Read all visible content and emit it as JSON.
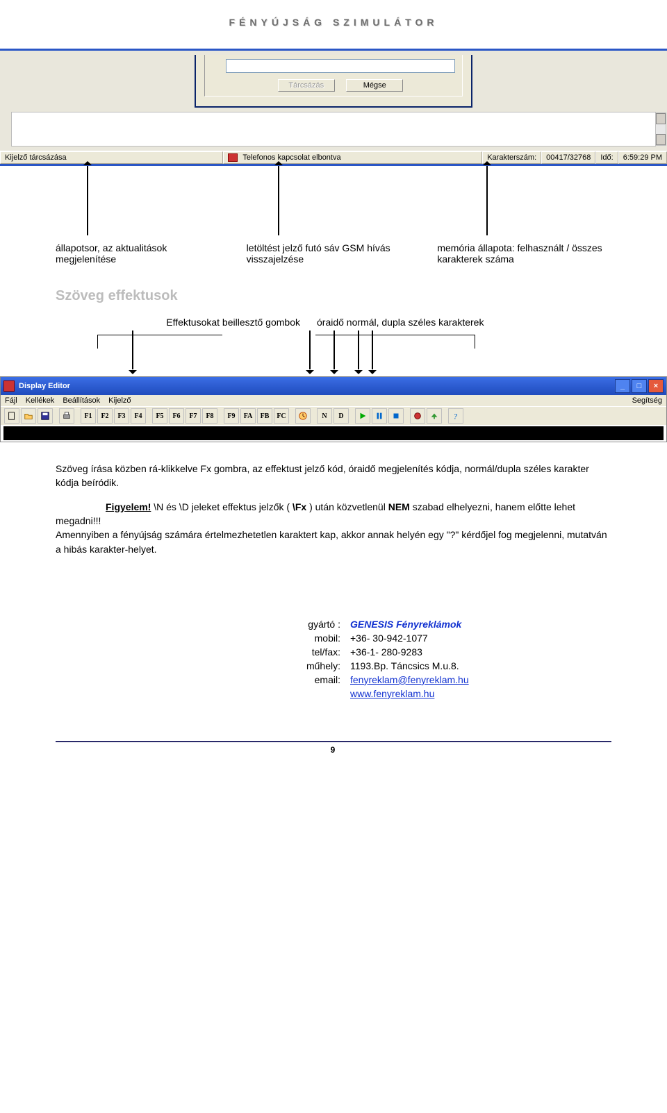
{
  "header_title": "FÉNYÚJSÁG SZIMULÁTOR",
  "dialog": {
    "btn_dial": "Tárcsázás",
    "btn_cancel": "Mégse"
  },
  "statusbar": {
    "cell1": "Kijelző tárcsázása",
    "cell2": "Telefonos kapcsolat elbontva",
    "cell3_label": "Karakterszám:",
    "cell3_value": "00417/32768",
    "cell4_label": "Idő:",
    "cell4_value": "6:59:29 PM"
  },
  "cols3": {
    "c1": "állapotsor, az aktualitások megjelenítése",
    "c2": "letöltést jelző futó sáv GSM hívás visszajelzése",
    "c3": "memória állapota: felhasznált / összes karakterek száma"
  },
  "section_title": "Szöveg effektusok",
  "bracket_labels": {
    "left": "Effektusokat beillesztő gombok",
    "right": "óraidő  normál, dupla széles  karakterek"
  },
  "editor": {
    "title": "Display Editor",
    "menus": [
      "Fájl",
      "Kellékek",
      "Beállítások",
      "Kijelző"
    ],
    "menu_right": "Segítség",
    "fx_buttons": [
      "F1",
      "F2",
      "F3",
      "F4",
      "F5",
      "F6",
      "F7",
      "F8",
      "F9",
      "FA",
      "FB",
      "FC"
    ],
    "nd_buttons": [
      "N",
      "D"
    ]
  },
  "para1": "Szöveg írása közben rá-klikkelve Fx gombra, az effektust jelző kód, óraidő megjelenítés kódja, normál/dupla széles karakter kódja beíródik.",
  "figyelem_label": "Figyelem!",
  "para2a": " \\N és \\D jeleket effektus jelzők ( ",
  "para2b": "\\Fx",
  "para2c": " ) után közvetlenül ",
  "para2d": "NEM",
  "para2e": " szabad elhelyezni, hanem előtte lehet megadni!!!",
  "para3": " Amennyiben a fényújság számára értelmezhetetlen karaktert kap, akkor annak helyén egy \"?\" kérdőjel fog megjelenni, mutatván a hibás karakter-helyet.",
  "contact": {
    "l1": "gyártó :",
    "v1": "GENESIS Fényreklámok",
    "l2": "mobil:",
    "v2": "+36- 30-942-1077",
    "l3": "tel/fax:",
    "v3": "+36-1- 280-9283",
    "l4": "műhely:",
    "v4": "1193.Bp. Táncsics M.u.8.",
    "l5": "email:",
    "v5": "fenyreklam@fenyreklam.hu",
    "v6": "www.fenyreklam.hu"
  },
  "page_number": "9"
}
